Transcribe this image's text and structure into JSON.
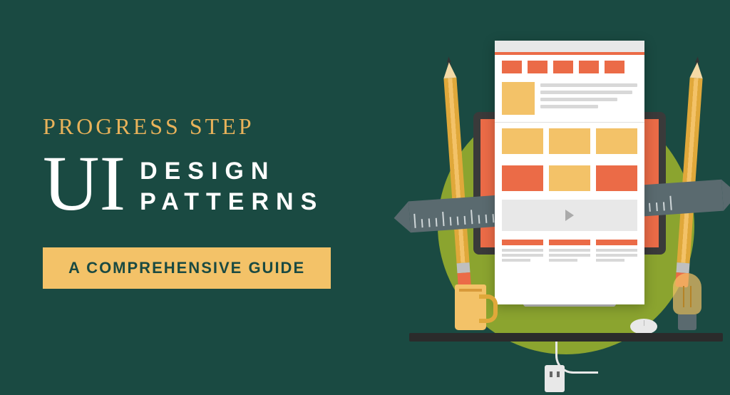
{
  "header": {
    "eyebrow": "PROGRESS STEP",
    "title_big": "UI",
    "title_line1": "DESIGN",
    "title_line2": "PATTERNS",
    "subtitle": "A COMPREHENSIVE GUIDE"
  },
  "colors": {
    "background": "#1a4a42",
    "accent_gold": "#f3c268",
    "accent_orange": "#eb6b47",
    "accent_olive": "#8ba42f"
  }
}
